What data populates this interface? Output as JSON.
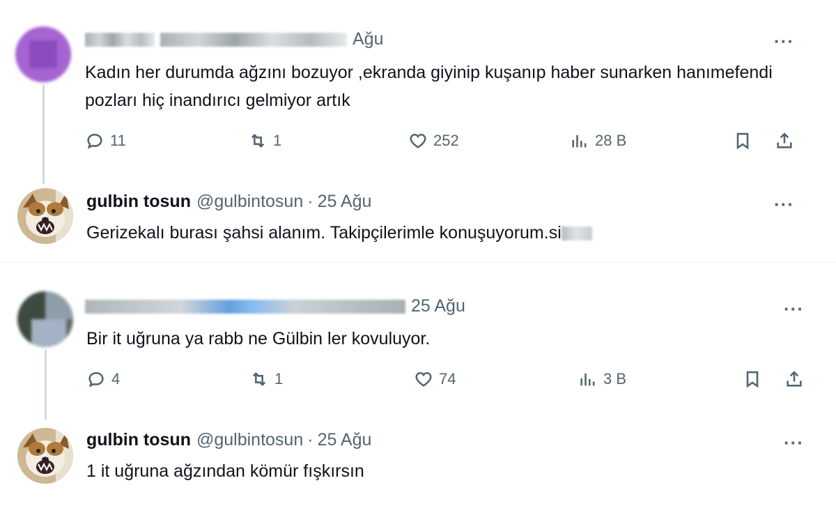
{
  "tweets": [
    {
      "name": "",
      "handle": "",
      "date": "Ağu",
      "text": "Kadın her durumda ağzını bozuyor ,ekranda giyinip kuşanıp haber sunarken hanımefendi pozları hiç inandırıcı gelmiyor artık",
      "replies": "11",
      "retweets": "1",
      "likes": "252",
      "views": "28 B"
    },
    {
      "name": "gulbin tosun",
      "handle": "@gulbintosun",
      "sep": "·",
      "date": "25 Ağu",
      "text": "Gerizekalı burası şahsi alanım. Takipçilerimle konuşuyorum.si"
    },
    {
      "name": "",
      "handle": "",
      "date": "25 Ağu",
      "text": "Bir it uğruna ya rabb ne Gülbin ler kovuluyor.",
      "replies": "4",
      "retweets": "1",
      "likes": "74",
      "views": "3 B"
    },
    {
      "name": "gulbin tosun",
      "handle": "@gulbintosun",
      "sep": "·",
      "date": "25 Ağu",
      "text": "1 it uğruna ağzından kömür fışkırsın"
    }
  ],
  "more_label": "···",
  "icons": [
    "reply-icon",
    "retweet-icon",
    "like-icon",
    "views-icon",
    "bookmark-icon",
    "share-icon"
  ],
  "colors": {
    "text": "#0f1419",
    "secondary": "#536471",
    "thread_line": "#cfd9de"
  }
}
